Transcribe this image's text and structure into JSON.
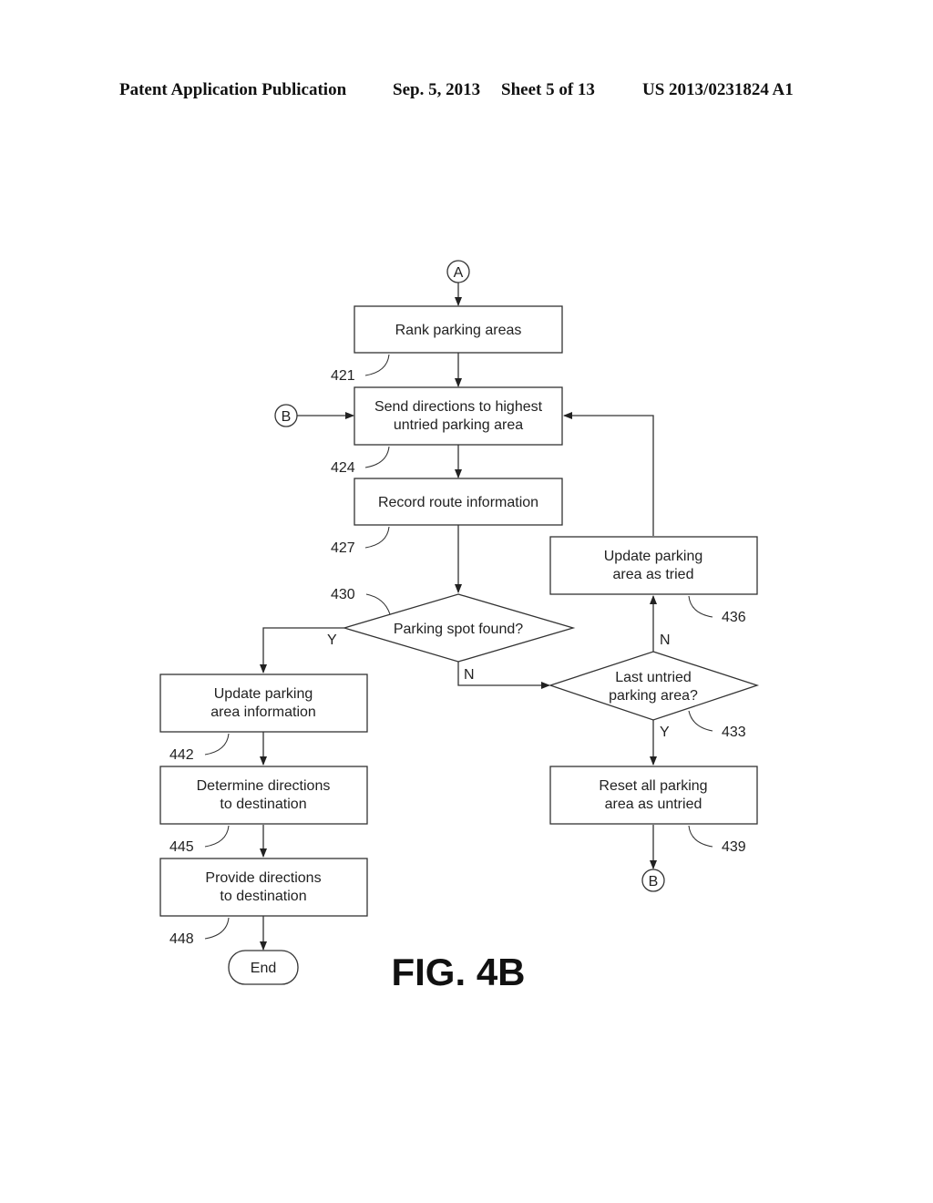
{
  "header": {
    "publication": "Patent Application Publication",
    "date": "Sep. 5, 2013",
    "sheet": "Sheet 5 of 13",
    "number": "US 2013/0231824 A1"
  },
  "figure_label": "FIG. 4B",
  "connectors": {
    "a": "A",
    "b_in": "B",
    "b_out": "B"
  },
  "nodes": {
    "rank": {
      "lines": [
        "Rank parking areas"
      ],
      "ref": "421"
    },
    "send": {
      "lines": [
        "Send directions to highest",
        "untried parking area"
      ],
      "ref": "424"
    },
    "record": {
      "lines": [
        "Record route information"
      ],
      "ref": "427"
    },
    "found": {
      "lines": [
        "Parking spot found?"
      ],
      "ref": "430"
    },
    "last": {
      "lines": [
        "Last untried",
        "parking area?"
      ],
      "ref": "433"
    },
    "tried": {
      "lines": [
        "Update parking",
        "area as tried"
      ],
      "ref": "436"
    },
    "reset": {
      "lines": [
        "Reset all parking",
        "area as untried"
      ],
      "ref": "439"
    },
    "update_info": {
      "lines": [
        "Update parking",
        "area information"
      ],
      "ref": "442"
    },
    "determine": {
      "lines": [
        "Determine directions",
        "to destination"
      ],
      "ref": "445"
    },
    "provide": {
      "lines": [
        "Provide directions",
        "to destination"
      ],
      "ref": "448"
    },
    "end": {
      "lines": [
        "End"
      ]
    }
  },
  "edge_labels": {
    "found_yes": "Y",
    "found_no": "N",
    "last_no": "N",
    "last_yes": "Y"
  }
}
